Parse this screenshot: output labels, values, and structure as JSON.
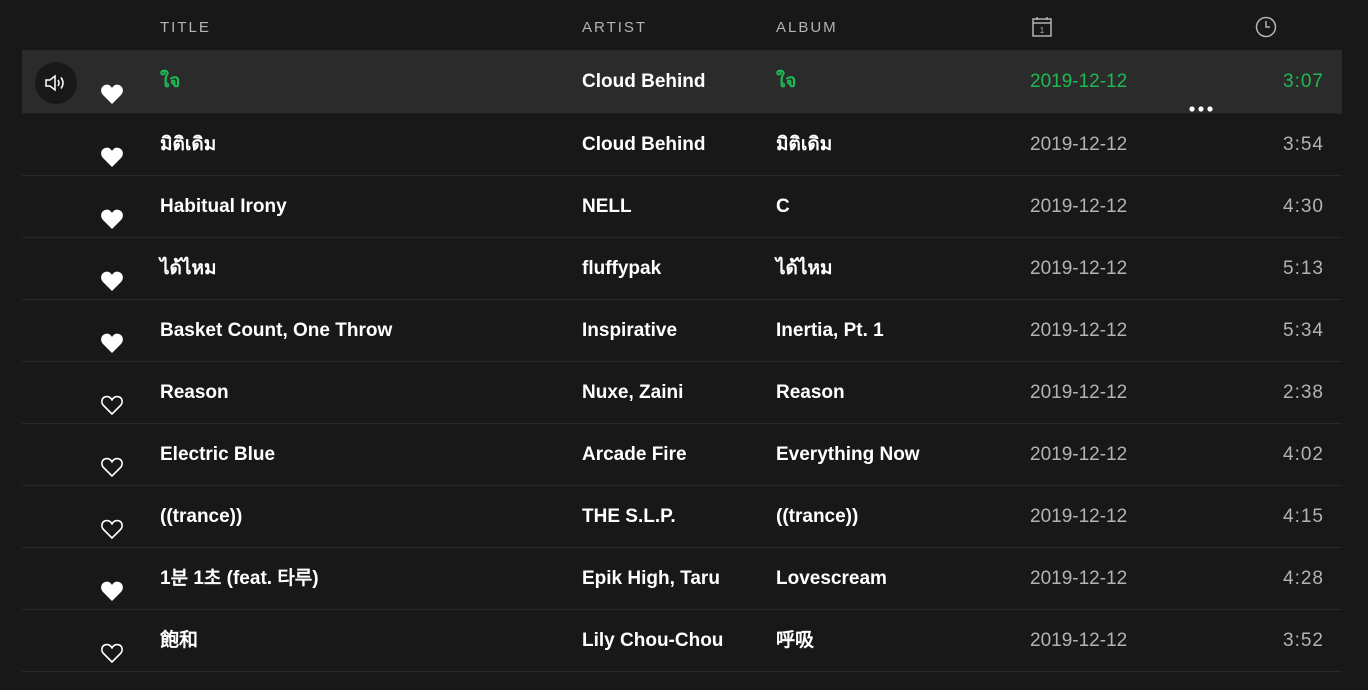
{
  "header": {
    "title_label": "TITLE",
    "artist_label": "ARTIST",
    "album_label": "ALBUM",
    "date_icon": "calendar-icon",
    "duration_icon": "clock-icon"
  },
  "colors": {
    "playing_accent": "#1db954",
    "background": "#181818",
    "row_highlight": "#2b2b2b",
    "muted_text": "#b3b3b3"
  },
  "tracks": [
    {
      "title": "ใจ",
      "artist": "Cloud Behind",
      "album": "ใจ",
      "date": "2019-12-12",
      "duration": "3:07",
      "liked": true,
      "playing": true
    },
    {
      "title": "มิติเดิม",
      "artist": "Cloud Behind",
      "album": "มิติเดิม",
      "date": "2019-12-12",
      "duration": "3:54",
      "liked": true
    },
    {
      "title": "Habitual Irony",
      "artist": "NELL",
      "album": "C",
      "date": "2019-12-12",
      "duration": "4:30",
      "liked": true
    },
    {
      "title": "ได้ไหม",
      "artist": "fluffypak",
      "album": "ได้ไหม",
      "date": "2019-12-12",
      "duration": "5:13",
      "liked": true
    },
    {
      "title": "Basket Count, One Throw",
      "artist": "Inspirative",
      "album": "Inertia, Pt. 1",
      "date": "2019-12-12",
      "duration": "5:34",
      "liked": true
    },
    {
      "title": "Reason",
      "artist": "Nuxe, Zaini",
      "album": "Reason",
      "date": "2019-12-12",
      "duration": "2:38",
      "liked": false
    },
    {
      "title": "Electric Blue",
      "artist": "Arcade Fire",
      "album": "Everything Now",
      "date": "2019-12-12",
      "duration": "4:02",
      "liked": false
    },
    {
      "title": "((trance))",
      "artist": "THE S.L.P.",
      "album": "((trance))",
      "date": "2019-12-12",
      "duration": "4:15",
      "liked": false
    },
    {
      "title": "1분 1초 (feat. 타루)",
      "artist": "Epik High, Taru",
      "album": "Lovescream",
      "date": "2019-12-12",
      "duration": "4:28",
      "liked": true
    },
    {
      "title": "飽和",
      "artist": "Lily Chou-Chou",
      "album": "呼吸",
      "date": "2019-12-12",
      "duration": "3:52",
      "liked": false
    }
  ]
}
